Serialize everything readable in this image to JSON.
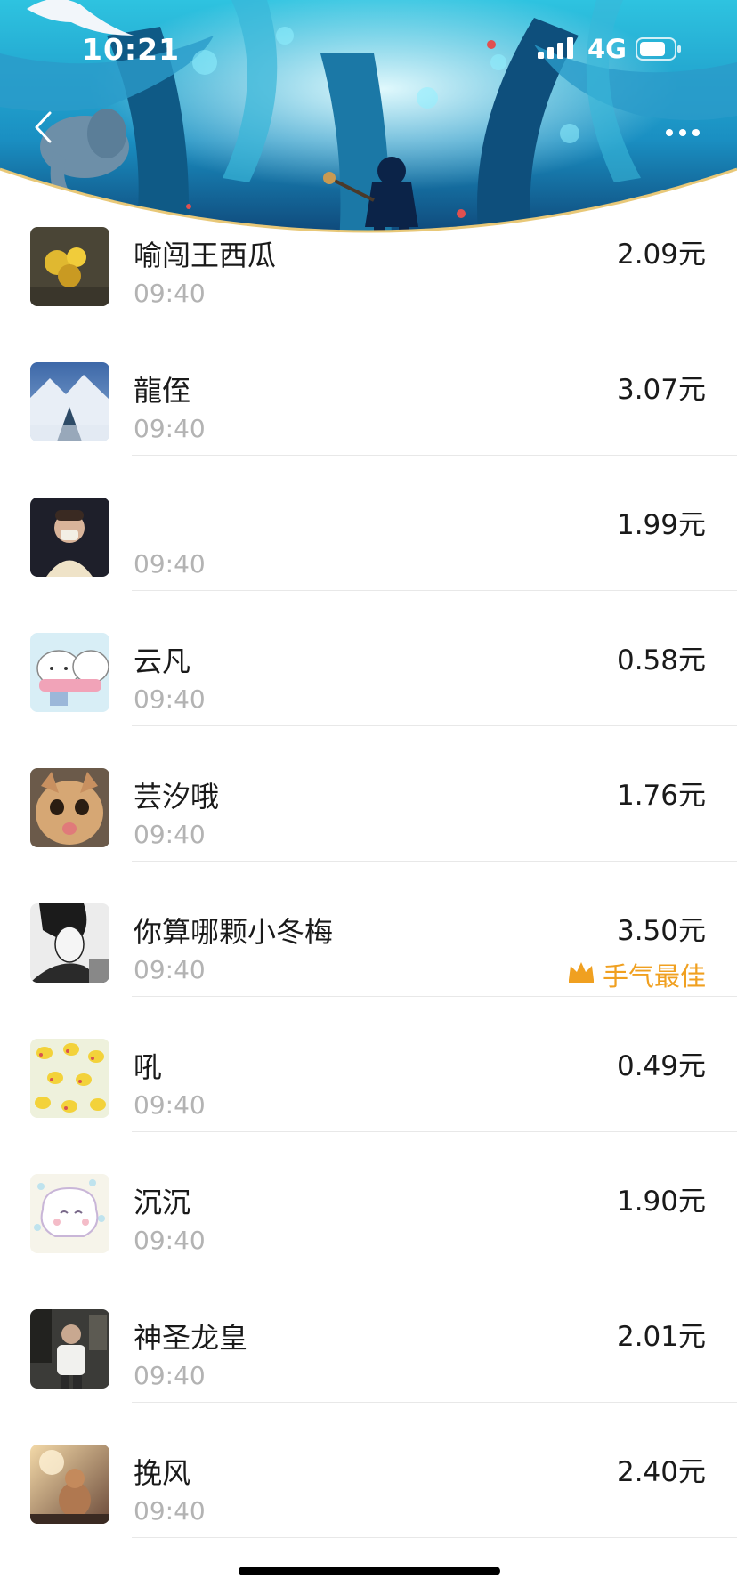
{
  "status_bar": {
    "time": "10:21",
    "network": "4G"
  },
  "header": {
    "back_icon": "chevron-left-icon",
    "more_icon": "more-horizontal-icon",
    "banner_colors": {
      "sky": "#3fd0e6",
      "deep": "#0d3a6b",
      "gold_trim": "#e8c878"
    }
  },
  "records": [
    {
      "name": "喻闯王西瓜",
      "time": "09:40",
      "amount": "2.09元",
      "avatar": "yellow-flowers"
    },
    {
      "name": "龍侄",
      "time": "09:40",
      "amount": "3.07元",
      "avatar": "snow-lake"
    },
    {
      "name": "",
      "time": "09:40",
      "amount": "1.99元",
      "avatar": "masked-boy"
    },
    {
      "name": "云凡",
      "time": "09:40",
      "amount": "0.58元",
      "avatar": "cartoon-cats"
    },
    {
      "name": "芸汐哦",
      "time": "09:40",
      "amount": "1.76元",
      "avatar": "orange-cat"
    },
    {
      "name": "你算哪颗小冬梅",
      "time": "09:40",
      "amount": "3.50元",
      "avatar": "bw-portrait",
      "best_luck": "手气最佳"
    },
    {
      "name": "吼",
      "time": "09:40",
      "amount": "0.49元",
      "avatar": "pikachu-pattern"
    },
    {
      "name": "沉沉",
      "time": "09:40",
      "amount": "1.90元",
      "avatar": "cartoon-sheep"
    },
    {
      "name": "神圣龙皇",
      "time": "09:40",
      "amount": "2.01元",
      "avatar": "man-in-room"
    },
    {
      "name": "挽风",
      "time": "09:40",
      "amount": "2.40元",
      "avatar": "sunset-pet"
    }
  ],
  "accent_colors": {
    "best_luck": "#f0a020",
    "text_primary": "#1a1a1a",
    "text_secondary": "#b3b3b3"
  }
}
